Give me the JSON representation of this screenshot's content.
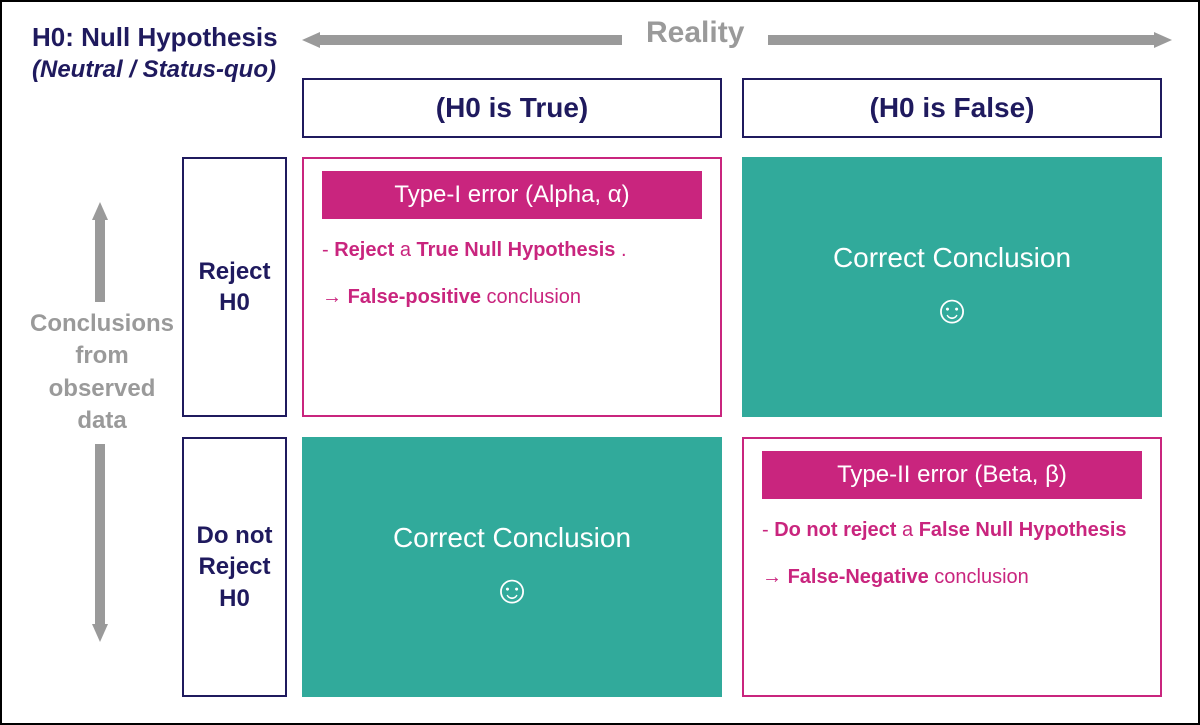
{
  "title": "H0: Null Hypothesis",
  "subtitle": "(Neutral / Status-quo)",
  "axes": {
    "horizontal": "Reality",
    "vertical": "Conclusions from observed data"
  },
  "columns": {
    "h0_true": "(H0 is True)",
    "h0_false": "(H0 is False)"
  },
  "rows": {
    "reject": "Reject H0",
    "not_reject": "Do not Reject H0"
  },
  "cells": {
    "type1": {
      "header": "Type-I error (Alpha, α)",
      "line1_pre": "- ",
      "line1_b1": "Reject",
      "line1_mid": " a ",
      "line1_b2": "True Null Hypothesis",
      "line1_post": ".",
      "line2_pre": "→ ",
      "line2_b": "False-positive",
      "line2_post": " conclusion"
    },
    "type2": {
      "header": "Type-II  error (Beta, β)",
      "line1_pre": "- ",
      "line1_b1": "Do not reject",
      "line1_mid": " a ",
      "line1_b2": "False Null Hypothesis",
      "line1_post": "",
      "line2_pre": "→ ",
      "line2_b": "False-Negative",
      "line2_post": " conclusion"
    },
    "correct": "Correct Conclusion",
    "smile": "☺"
  },
  "colors": {
    "navy": "#1f1a5e",
    "grey": "#9a9a9a",
    "pink": "#c9257e",
    "teal": "#31aa9b"
  }
}
